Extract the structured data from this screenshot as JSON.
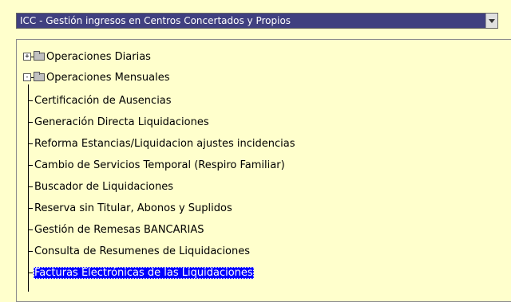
{
  "selector": {
    "value": "ICC - Gestión ingresos en Centros Concertados y Propios"
  },
  "tree": {
    "folders": [
      {
        "label": "Operaciones Diarias",
        "expanded": false,
        "toggle": "+"
      },
      {
        "label": "Operaciones Mensuales",
        "expanded": true,
        "toggle": "-"
      }
    ],
    "items": [
      {
        "label": "Certificación de Ausencias"
      },
      {
        "label": "Generación Directa Liquidaciones"
      },
      {
        "label": "Reforma Estancias/Liquidacion ajustes incidencias"
      },
      {
        "label": "Cambio de Servicios Temporal (Respiro Familiar)"
      },
      {
        "label": "Buscador de Liquidaciones"
      },
      {
        "label": "Reserva sin Titular, Abonos y Suplidos"
      },
      {
        "label": "Gestión de Remesas BANCARIAS"
      },
      {
        "label": "Consulta de Resumenes de Liquidaciones"
      },
      {
        "label": "Facturas Electrónicas de las Liquidaciones",
        "selected": true
      }
    ]
  },
  "colors": {
    "background": "#ffffcc",
    "selector_background": "#404080",
    "selection": "#0000ff"
  },
  "icons": {
    "folder": "folder-icon",
    "toggle": "tree-toggle-icon",
    "dropdown": "dropdown-arrow-icon"
  }
}
